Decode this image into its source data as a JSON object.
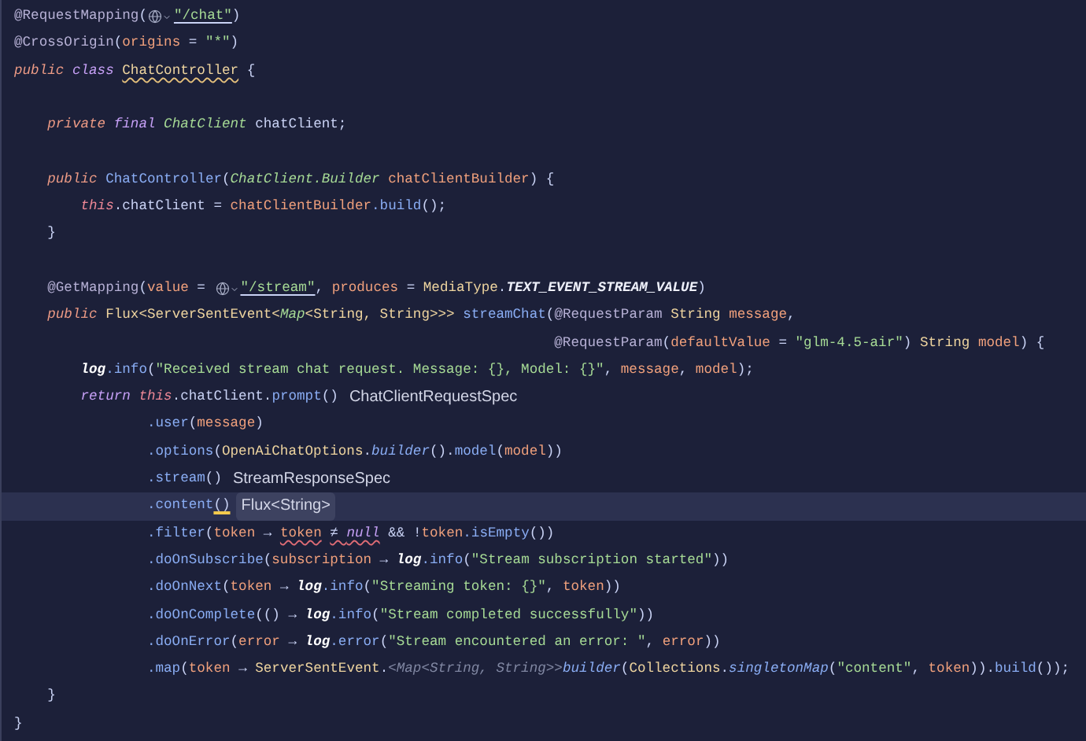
{
  "editor": {
    "lines": [
      {
        "selected": false,
        "tokens": [
          {
            "kind": "annotation",
            "text": "@RequestMapping"
          },
          {
            "kind": "plain",
            "text": "("
          },
          {
            "kind": "link_icon"
          },
          {
            "kind": "link_string",
            "text": "\"/chat\""
          },
          {
            "kind": "plain",
            "text": ")"
          }
        ]
      },
      {
        "selected": false,
        "tokens": [
          {
            "kind": "annotation",
            "text": "@CrossOrigin"
          },
          {
            "kind": "plain",
            "text": "("
          },
          {
            "kind": "param",
            "text": "origins"
          },
          {
            "kind": "plain",
            "text": " = "
          },
          {
            "kind": "string",
            "text": "\"*\""
          },
          {
            "kind": "plain",
            "text": ")"
          }
        ]
      },
      {
        "selected": false,
        "tokens": [
          {
            "kind": "modifier",
            "text": "public"
          },
          {
            "kind": "keyword",
            "text": " class "
          },
          {
            "kind": "type_warning",
            "text": "ChatController"
          },
          {
            "kind": "plain",
            "text": " {"
          }
        ]
      },
      {
        "selected": false
      },
      {
        "selected": false,
        "tokens": [
          {
            "kind": "modifier",
            "text": "    private"
          },
          {
            "kind": "keyword",
            "text": " final "
          },
          {
            "kind": "type_italic",
            "text": "ChatClient"
          },
          {
            "kind": "plain",
            "text": " chatClient;"
          }
        ]
      },
      {
        "selected": false
      },
      {
        "selected": false,
        "tokens": [
          {
            "kind": "modifier",
            "text": "    public"
          },
          {
            "kind": "method",
            "text": " ChatController"
          },
          {
            "kind": "plain",
            "text": "("
          },
          {
            "kind": "type_italic",
            "text": "ChatClient.Builder"
          },
          {
            "kind": "param",
            "text": " chatClientBuilder"
          },
          {
            "kind": "plain",
            "text": ") {"
          }
        ]
      },
      {
        "selected": false,
        "tokens": [
          {
            "kind": "this",
            "text": "        this"
          },
          {
            "kind": "plain",
            "text": ".chatClient = "
          },
          {
            "kind": "param",
            "text": "chatClientBuilder"
          },
          {
            "kind": "method",
            "text": ".build"
          },
          {
            "kind": "plain",
            "text": "();"
          }
        ]
      },
      {
        "selected": false,
        "tokens": [
          {
            "kind": "plain",
            "text": "    }"
          }
        ]
      },
      {
        "selected": false
      },
      {
        "selected": false,
        "tokens": [
          {
            "kind": "annotation",
            "text": "    @GetMapping"
          },
          {
            "kind": "plain",
            "text": "("
          },
          {
            "kind": "param",
            "text": "value"
          },
          {
            "kind": "plain",
            "text": " = "
          },
          {
            "kind": "link_icon"
          },
          {
            "kind": "link_string",
            "text": "\"/stream\""
          },
          {
            "kind": "plain",
            "text": ", "
          },
          {
            "kind": "param",
            "text": "produces"
          },
          {
            "kind": "plain",
            "text": " = "
          },
          {
            "kind": "type",
            "text": "MediaType"
          },
          {
            "kind": "plain",
            "text": "."
          },
          {
            "kind": "static",
            "text": "TEXT_EVENT_STREAM_VALUE"
          },
          {
            "kind": "plain",
            "text": ")"
          }
        ]
      },
      {
        "selected": false,
        "tokens": [
          {
            "kind": "modifier",
            "text": "    public"
          },
          {
            "kind": "type",
            "text": " Flux<ServerSentEvent<"
          },
          {
            "kind": "type_italic",
            "text": "Map"
          },
          {
            "kind": "type",
            "text": "<String, String>>>"
          },
          {
            "kind": "method",
            "text": " streamChat"
          },
          {
            "kind": "plain",
            "text": "("
          },
          {
            "kind": "annotation",
            "text": "@RequestParam"
          },
          {
            "kind": "type",
            "text": " String "
          },
          {
            "kind": "param",
            "text": "message"
          },
          {
            "kind": "plain",
            "text": ","
          }
        ]
      },
      {
        "selected": false,
        "tokens": [
          {
            "kind": "annotation",
            "text": "                                                                 @RequestParam"
          },
          {
            "kind": "plain",
            "text": "("
          },
          {
            "kind": "param",
            "text": "defaultValue"
          },
          {
            "kind": "plain",
            "text": " = "
          },
          {
            "kind": "string",
            "text": "\"glm-4.5-air\""
          },
          {
            "kind": "plain",
            "text": ") "
          },
          {
            "kind": "type",
            "text": "String"
          },
          {
            "kind": "param",
            "text": " model"
          },
          {
            "kind": "plain",
            "text": ") {"
          }
        ]
      },
      {
        "selected": false,
        "tokens": [
          {
            "kind": "log",
            "text": "        log"
          },
          {
            "kind": "method",
            "text": ".info"
          },
          {
            "kind": "plain",
            "text": "("
          },
          {
            "kind": "string",
            "text": "\"Received stream chat request. Message: {}, Model: {}\""
          },
          {
            "kind": "plain",
            "text": ", "
          },
          {
            "kind": "param",
            "text": "message"
          },
          {
            "kind": "plain",
            "text": ", "
          },
          {
            "kind": "param",
            "text": "model"
          },
          {
            "kind": "plain",
            "text": ");"
          }
        ]
      },
      {
        "selected": false,
        "tokens": [
          {
            "kind": "keyword",
            "text": "        return"
          },
          {
            "kind": "this",
            "text": " this"
          },
          {
            "kind": "plain",
            "text": ".chatClient."
          },
          {
            "kind": "method",
            "text": "prompt"
          },
          {
            "kind": "plain",
            "text": "()"
          },
          {
            "kind": "hint",
            "text": "ChatClientRequestSpec"
          }
        ]
      },
      {
        "selected": false,
        "tokens": [
          {
            "kind": "method",
            "text": "                .user"
          },
          {
            "kind": "plain",
            "text": "("
          },
          {
            "kind": "param",
            "text": "message"
          },
          {
            "kind": "plain",
            "text": ")"
          }
        ]
      },
      {
        "selected": false,
        "tokens": [
          {
            "kind": "method",
            "text": "                .options"
          },
          {
            "kind": "plain",
            "text": "("
          },
          {
            "kind": "type",
            "text": "OpenAiChatOptions"
          },
          {
            "kind": "plain",
            "text": "."
          },
          {
            "kind": "method_italic",
            "text": "builder"
          },
          {
            "kind": "plain",
            "text": "()."
          },
          {
            "kind": "method",
            "text": "model"
          },
          {
            "kind": "plain",
            "text": "("
          },
          {
            "kind": "param",
            "text": "model"
          },
          {
            "kind": "plain",
            "text": "))"
          }
        ]
      },
      {
        "selected": false,
        "tokens": [
          {
            "kind": "method",
            "text": "                .stream"
          },
          {
            "kind": "plain",
            "text": "()"
          },
          {
            "kind": "hint",
            "text": "StreamResponseSpec"
          }
        ]
      },
      {
        "selected": true,
        "tokens": [
          {
            "kind": "method",
            "text": "                .content"
          },
          {
            "kind": "brace_match",
            "text": "()"
          },
          {
            "kind": "hint",
            "text": "Flux<String>"
          }
        ]
      },
      {
        "selected": false,
        "tokens": [
          {
            "kind": "method",
            "text": "                .filter"
          },
          {
            "kind": "plain",
            "text": "("
          },
          {
            "kind": "param",
            "text": "token"
          },
          {
            "kind": "plain",
            "text": " → "
          },
          {
            "kind": "param_error",
            "text": "token"
          },
          {
            "kind": "plain_error",
            "text": " ≠ "
          },
          {
            "kind": "keyword_error",
            "text": "null"
          },
          {
            "kind": "plain",
            "text": " && !"
          },
          {
            "kind": "param",
            "text": "token"
          },
          {
            "kind": "method",
            "text": ".isEmpty"
          },
          {
            "kind": "plain",
            "text": "())"
          }
        ]
      },
      {
        "selected": false,
        "tokens": [
          {
            "kind": "method",
            "text": "                .doOnSubscribe"
          },
          {
            "kind": "plain",
            "text": "("
          },
          {
            "kind": "param",
            "text": "subscription"
          },
          {
            "kind": "plain",
            "text": " → "
          },
          {
            "kind": "log",
            "text": "log"
          },
          {
            "kind": "method",
            "text": ".info"
          },
          {
            "kind": "plain",
            "text": "("
          },
          {
            "kind": "string",
            "text": "\"Stream subscription started\""
          },
          {
            "kind": "plain",
            "text": "))"
          }
        ]
      },
      {
        "selected": false,
        "tokens": [
          {
            "kind": "method",
            "text": "                .doOnNext"
          },
          {
            "kind": "plain",
            "text": "("
          },
          {
            "kind": "param",
            "text": "token"
          },
          {
            "kind": "plain",
            "text": " → "
          },
          {
            "kind": "log",
            "text": "log"
          },
          {
            "kind": "method",
            "text": ".info"
          },
          {
            "kind": "plain",
            "text": "("
          },
          {
            "kind": "string",
            "text": "\"Streaming token: {}\""
          },
          {
            "kind": "plain",
            "text": ", "
          },
          {
            "kind": "param",
            "text": "token"
          },
          {
            "kind": "plain",
            "text": "))"
          }
        ]
      },
      {
        "selected": false,
        "tokens": [
          {
            "kind": "method",
            "text": "                .doOnComplete"
          },
          {
            "kind": "plain",
            "text": "(() → "
          },
          {
            "kind": "log",
            "text": "log"
          },
          {
            "kind": "method",
            "text": ".info"
          },
          {
            "kind": "plain",
            "text": "("
          },
          {
            "kind": "string",
            "text": "\"Stream completed successfully\""
          },
          {
            "kind": "plain",
            "text": "))"
          }
        ]
      },
      {
        "selected": false,
        "tokens": [
          {
            "kind": "method",
            "text": "                .doOnError"
          },
          {
            "kind": "plain",
            "text": "("
          },
          {
            "kind": "param",
            "text": "error"
          },
          {
            "kind": "plain",
            "text": " → "
          },
          {
            "kind": "log",
            "text": "log"
          },
          {
            "kind": "method",
            "text": ".error"
          },
          {
            "kind": "plain",
            "text": "("
          },
          {
            "kind": "string",
            "text": "\"Stream encountered an error: \""
          },
          {
            "kind": "plain",
            "text": ", "
          },
          {
            "kind": "param",
            "text": "error"
          },
          {
            "kind": "plain",
            "text": "))"
          }
        ]
      },
      {
        "selected": false,
        "tokens": [
          {
            "kind": "method",
            "text": "                .map"
          },
          {
            "kind": "plain",
            "text": "("
          },
          {
            "kind": "param",
            "text": "token"
          },
          {
            "kind": "plain",
            "text": " → "
          },
          {
            "kind": "type",
            "text": "ServerSentEvent"
          },
          {
            "kind": "plain",
            "text": "."
          },
          {
            "kind": "generic",
            "text": "<Map<String, String>>"
          },
          {
            "kind": "method_italic",
            "text": "builder"
          },
          {
            "kind": "plain",
            "text": "("
          },
          {
            "kind": "type",
            "text": "Collections"
          },
          {
            "kind": "plain",
            "text": "."
          },
          {
            "kind": "method_italic",
            "text": "singletonMap"
          },
          {
            "kind": "plain",
            "text": "("
          },
          {
            "kind": "string",
            "text": "\"content\""
          },
          {
            "kind": "plain",
            "text": ", "
          },
          {
            "kind": "param",
            "text": "token"
          },
          {
            "kind": "plain",
            "text": "))."
          },
          {
            "kind": "method",
            "text": "build"
          },
          {
            "kind": "plain",
            "text": "());"
          }
        ]
      },
      {
        "selected": false,
        "tokens": [
          {
            "kind": "plain",
            "text": "    }"
          }
        ]
      },
      {
        "selected": false,
        "tokens": [
          {
            "kind": "plain",
            "text": "}"
          }
        ]
      }
    ]
  }
}
